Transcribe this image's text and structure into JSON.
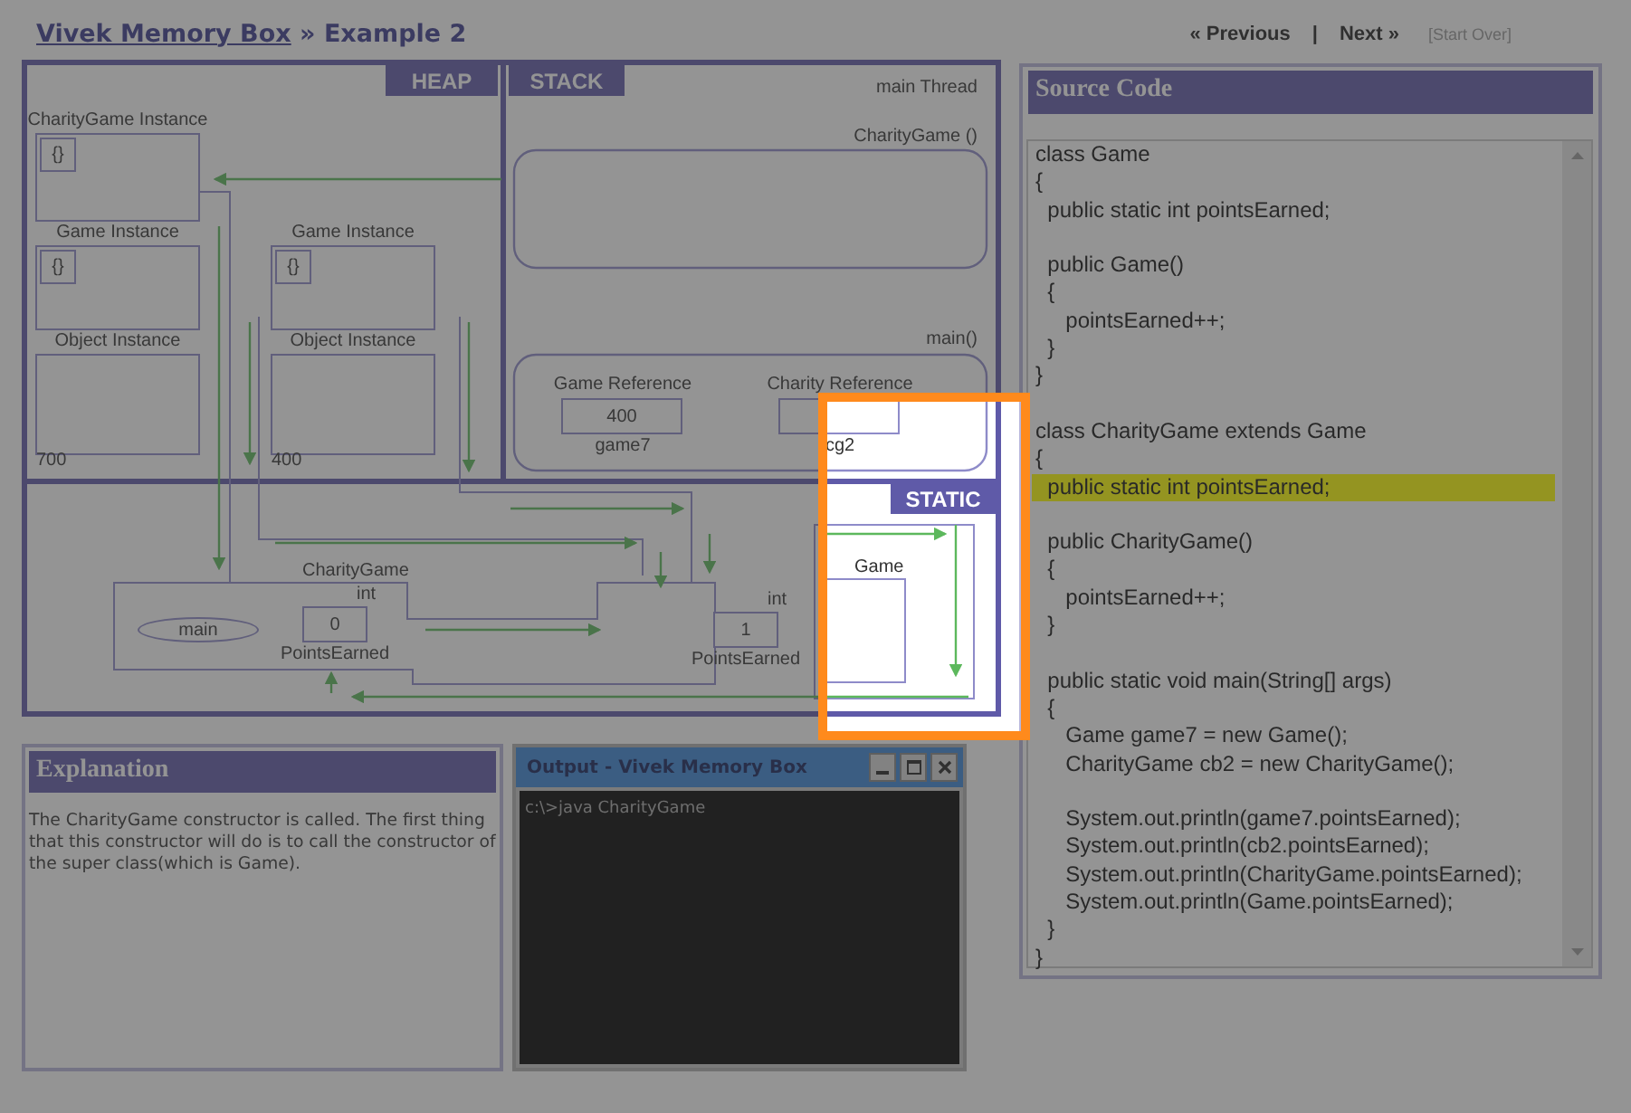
{
  "header": {
    "link": "Vivek Memory Box",
    "subtitle": " » Example 2"
  },
  "nav": {
    "previous": "« Previous",
    "separator": "|",
    "next": "Next »",
    "restart": "[Start Over]",
    "restart_disabled": true
  },
  "memory": {
    "heap_label": "HEAP",
    "stack_label": "STACK",
    "static_label": "STATIC",
    "thread_label": "main Thread",
    "heap_columns": [
      {
        "instances": [
          {
            "title": "CharityGame Instance",
            "body": "{}"
          },
          {
            "title": "Game Instance",
            "body": "{}"
          },
          {
            "title": "Object Instance"
          }
        ],
        "address": "700"
      },
      {
        "instances": [
          {
            "title": "Game Instance",
            "body": "{}"
          },
          {
            "title": "Object Instance"
          }
        ],
        "address": "400"
      }
    ],
    "stack_frames": [
      {
        "name": "CharityGame ()"
      },
      {
        "name": "main()",
        "variables": [
          {
            "type": "Game Reference",
            "value": "400",
            "name": "game7"
          },
          {
            "type": "Charity Reference",
            "name": "cg2"
          }
        ]
      }
    ],
    "static_classes": [
      {
        "name": "CharityGame",
        "method": "main",
        "field_type": "int",
        "field_value": "0",
        "field_name": "PointsEarned"
      },
      {
        "name": "Game",
        "field_type": "int",
        "field_value": "1",
        "field_name": "PointsEarned"
      }
    ]
  },
  "explanation": {
    "title": "Explanation",
    "text": "The CharityGame constructor is called. The first thing that this constructor will do is to call the constructor of the super class(which is Game)."
  },
  "output_window": {
    "title": "Output - Vivek Memory Box",
    "lines": [
      "c:\\>java CharityGame"
    ]
  },
  "source": {
    "title": "Source Code",
    "blocks": [
      [
        {
          "text": "class Game",
          "highlighted": false
        },
        {
          "text": "{",
          "highlighted": false
        },
        {
          "text": "  public static int pointsEarned;",
          "highlighted": false
        }
      ],
      [
        {
          "text": "  public Game()",
          "highlighted": false
        },
        {
          "text": "  {",
          "highlighted": false
        },
        {
          "text": "     pointsEarned++;",
          "highlighted": false
        },
        {
          "text": "  }",
          "highlighted": false
        },
        {
          "text": "}",
          "highlighted": false
        }
      ],
      [
        {
          "text": "class CharityGame extends Game",
          "highlighted": false
        },
        {
          "text": "{",
          "highlighted": false
        },
        {
          "text": "  public static int pointsEarned;",
          "highlighted": true
        }
      ],
      [
        {
          "text": "  public CharityGame()",
          "highlighted": false
        },
        {
          "text": "  {",
          "highlighted": false
        },
        {
          "text": "     pointsEarned++;",
          "highlighted": false
        },
        {
          "text": "  }",
          "highlighted": false
        }
      ],
      [
        {
          "text": "  public static void main(String[] args)",
          "highlighted": false
        },
        {
          "text": "  {",
          "highlighted": false
        },
        {
          "text": "     Game game7 = new Game();",
          "highlighted": false
        },
        {
          "text": "     CharityGame cb2 = new CharityGame();",
          "highlighted": false
        }
      ],
      [
        {
          "text": "     System.out.println(game7.pointsEarned);",
          "highlighted": false
        },
        {
          "text": "     System.out.println(cb2.pointsEarned);",
          "highlighted": false
        },
        {
          "text": "     System.out.println(CharityGame.pointsEarned);",
          "highlighted": false
        },
        {
          "text": "     System.out.println(Game.pointsEarned);",
          "highlighted": false
        },
        {
          "text": "  }",
          "highlighted": false
        },
        {
          "text": "}",
          "highlighted": false
        }
      ]
    ]
  }
}
